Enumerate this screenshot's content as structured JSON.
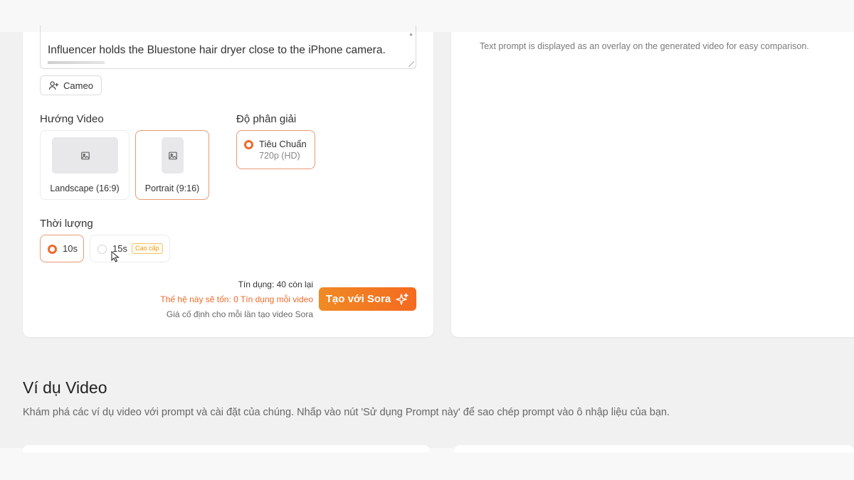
{
  "prompt": {
    "text": "Influencer holds the Bluestone hair dryer close to the iPhone camera."
  },
  "cameo_label": "Cameo",
  "preview": {
    "overlay_note": "Text prompt is displayed as an overlay on the generated video for easy comparison."
  },
  "orientation": {
    "label": "Hướng Video",
    "options": [
      {
        "label": "Landscape (16:9)",
        "selected": false
      },
      {
        "label": "Portrait (9:16)",
        "selected": true
      }
    ]
  },
  "resolution": {
    "label": "Độ phân giải",
    "option": {
      "title": "Tiêu Chuẩn",
      "subtitle": "720p (HD)",
      "selected": true
    }
  },
  "duration": {
    "label": "Thời lượng",
    "options": [
      {
        "label": "10s",
        "selected": true
      },
      {
        "label": "15s",
        "selected": false,
        "badge": "Cao cấp"
      }
    ]
  },
  "footer": {
    "credits": "Tín dụng: 40 còn lại",
    "cost": "Thế hệ này sẽ tốn: 0 Tín dụng mỗi video",
    "fixed_price": "Giá cố định cho mỗi lần tạo video Sora",
    "create_button": "Tạo với Sora"
  },
  "examples": {
    "title": "Ví dụ Video",
    "description": "Khám phá các ví dụ video với prompt và cài đặt của chúng. Nhấp vào nút 'Sử dụng Prompt này' để sao chép prompt vào ô nhập liệu của bạn."
  },
  "colors": {
    "accent": "#ee6a2a",
    "selected_border": "#e79a74",
    "premium": "#e0a020"
  }
}
